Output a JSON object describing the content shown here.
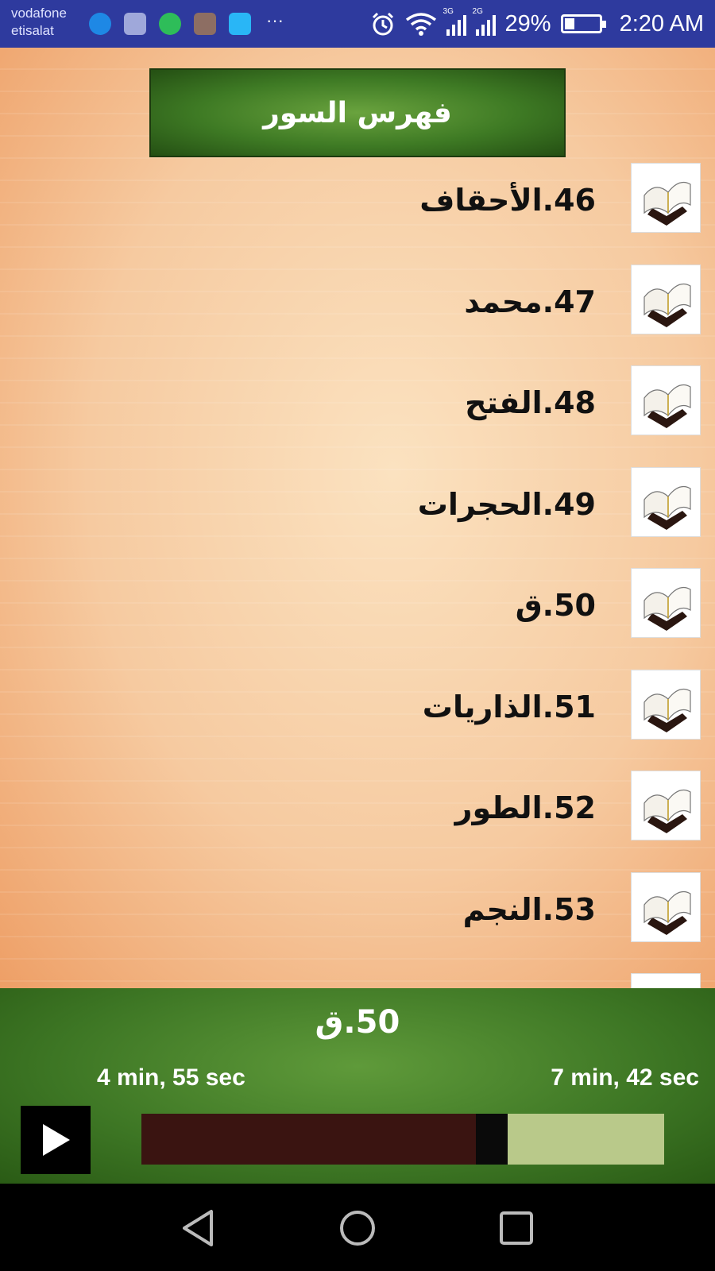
{
  "status_bar": {
    "carrier_1": "vodafone",
    "carrier_2": "etisalat",
    "signal_1_tag": "3G",
    "signal_2_tag": "2G",
    "battery": "29%",
    "time": "2:20 AM",
    "notification_icons": [
      "messenger-icon",
      "gallery-icon",
      "whatsapp-icon",
      "photo-icon",
      "chat-icon",
      "more-icon"
    ]
  },
  "header": {
    "title": "فهرس السور"
  },
  "surahs": [
    {
      "label": "46.الأحقاف"
    },
    {
      "label": "47.محمد"
    },
    {
      "label": "48.الفتح"
    },
    {
      "label": "49.الحجرات"
    },
    {
      "label": "50.ق"
    },
    {
      "label": "51.الذاريات"
    },
    {
      "label": "52.الطور"
    },
    {
      "label": "53.النجم"
    }
  ],
  "player": {
    "now_playing": "50.ق",
    "elapsed": "4 min, 55 sec",
    "total": "7 min, 42 sec",
    "progress_fraction": 0.64,
    "buffered_fraction": 0.7
  },
  "colors": {
    "status_bar": "#2e3a9e",
    "header_green": "#3e7a24",
    "played": "#3a1411",
    "remaining": "#b9c98a"
  }
}
